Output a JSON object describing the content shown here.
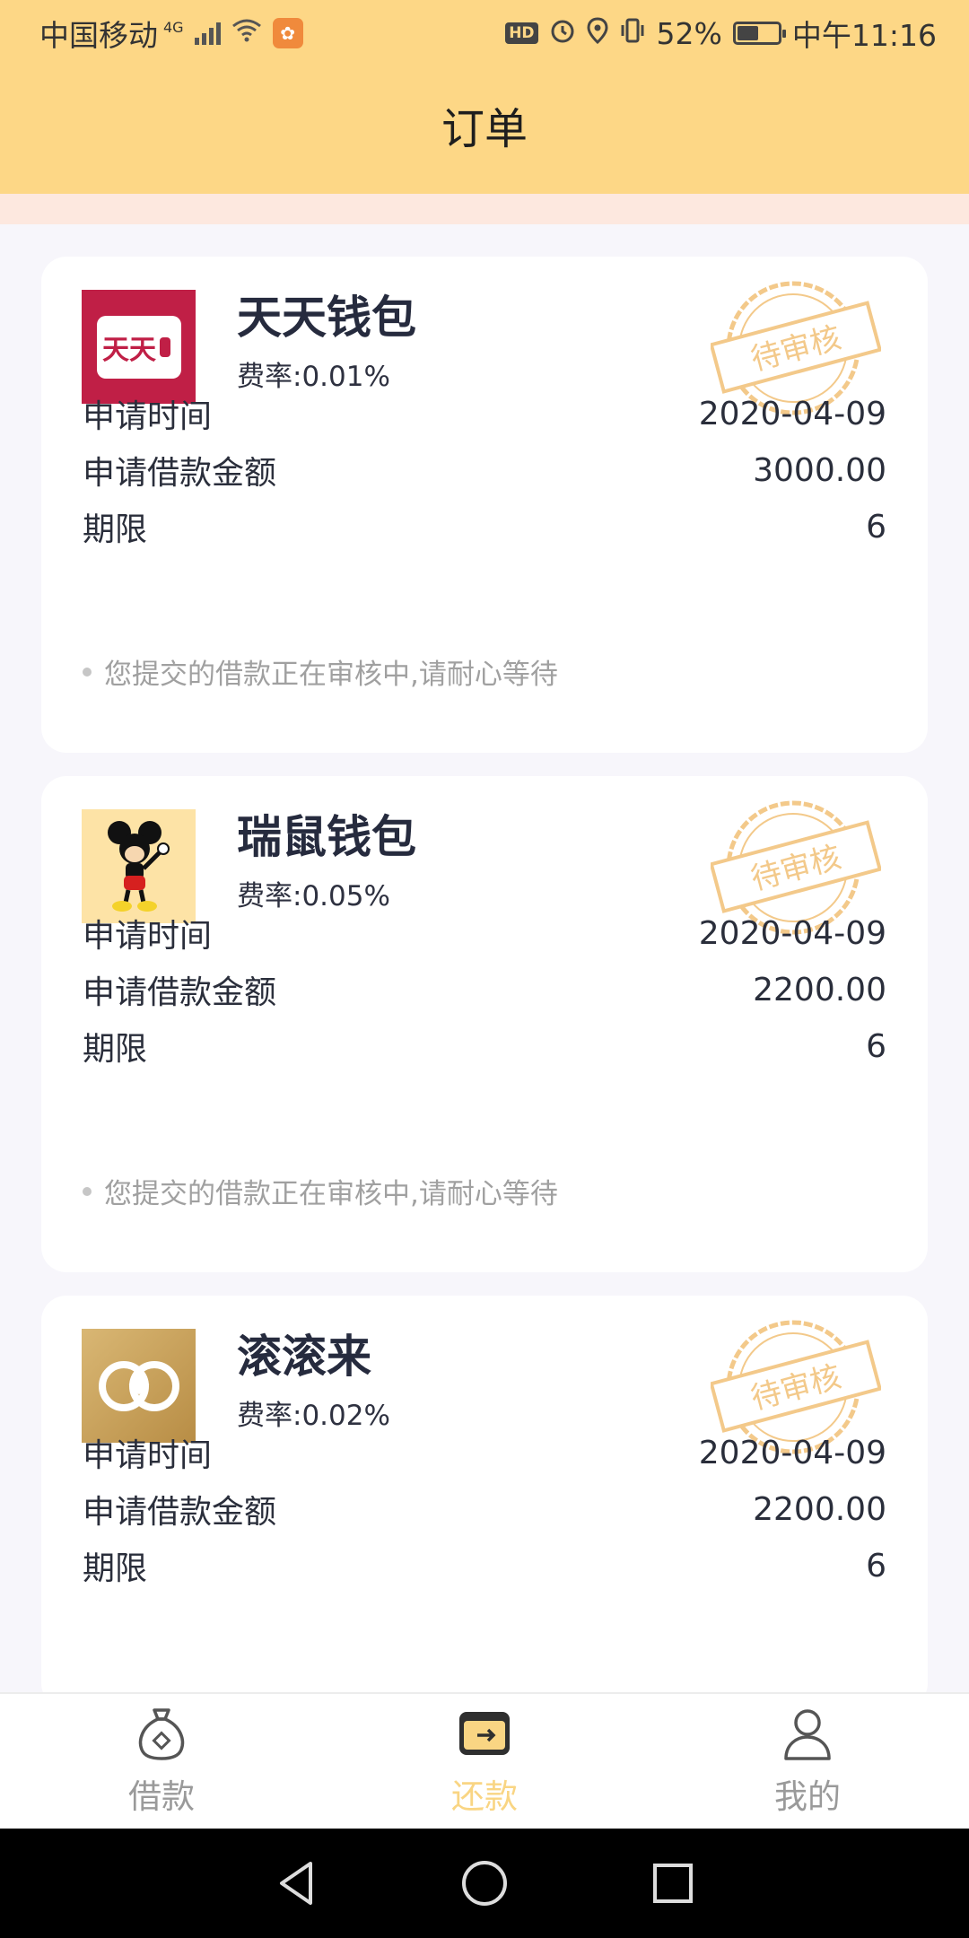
{
  "status_bar": {
    "carrier": "中国移动",
    "network": "4G",
    "hd": "HD",
    "battery_percent": "52%",
    "battery_level": 0.52,
    "time": "中午11:16"
  },
  "header": {
    "title": "订单"
  },
  "orders": [
    {
      "name": "天天钱包",
      "rate": "费率:0.01%",
      "logo_icon": "wallet-logo-icon",
      "logo_text": "天天",
      "stamp": "待审核",
      "rows": [
        {
          "label": "申请时间",
          "value": "2020-04-09"
        },
        {
          "label": "申请借款金额",
          "value": "3000.00"
        },
        {
          "label": "期限",
          "value": "6"
        }
      ],
      "note": "您提交的借款正在审核中,请耐心等待"
    },
    {
      "name": "瑞鼠钱包",
      "rate": "费率:0.05%",
      "logo_icon": "mouse-cartoon-logo-icon",
      "stamp": "待审核",
      "rows": [
        {
          "label": "申请时间",
          "value": "2020-04-09"
        },
        {
          "label": "申请借款金额",
          "value": "2200.00"
        },
        {
          "label": "期限",
          "value": "6"
        }
      ],
      "note": "您提交的借款正在审核中,请耐心等待"
    },
    {
      "name": "滚滚来",
      "rate": "费率:0.02%",
      "logo_icon": "interlocked-rings-logo-icon",
      "stamp": "待审核",
      "rows": [
        {
          "label": "申请时间",
          "value": "2020-04-09"
        },
        {
          "label": "申请借款金额",
          "value": "2200.00"
        },
        {
          "label": "期限",
          "value": "6"
        }
      ]
    }
  ],
  "tabs": [
    {
      "label": "借款",
      "icon": "money-bag-icon",
      "active": false
    },
    {
      "label": "还款",
      "icon": "wallet-card-icon",
      "active": true
    },
    {
      "label": "我的",
      "icon": "user-icon",
      "active": false
    }
  ],
  "colors": {
    "header_bg": "#fdd786",
    "accent": "#f9d583",
    "stamp": "#f3c98a",
    "tab_inactive": "#9a9a9a"
  }
}
